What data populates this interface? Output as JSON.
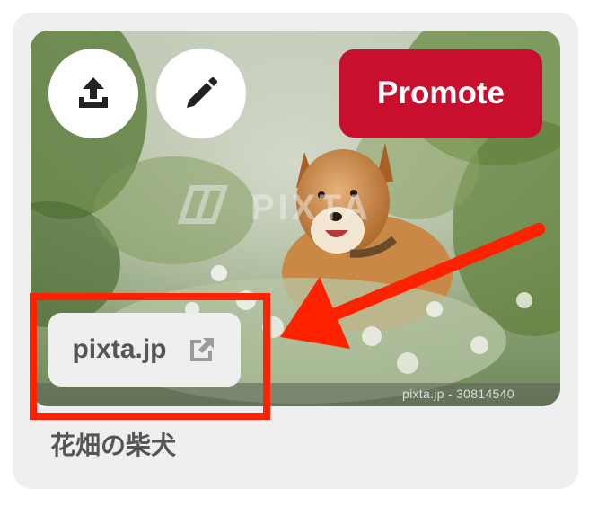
{
  "pin": {
    "title": "花畑の柴犬",
    "source_domain": "pixta.jp",
    "photo_credit": "pixta.jp - 30814540",
    "watermark": "PIXTA"
  },
  "actions": {
    "share_icon": "share-upload-icon",
    "edit_icon": "pencil-icon",
    "promote_label": "Promote",
    "external_link_icon": "external-link-icon"
  },
  "annotation": {
    "highlight": "source-link",
    "color": "#ff2200"
  },
  "colors": {
    "promote_bg": "#c8102e",
    "card_bg": "#efefef"
  }
}
